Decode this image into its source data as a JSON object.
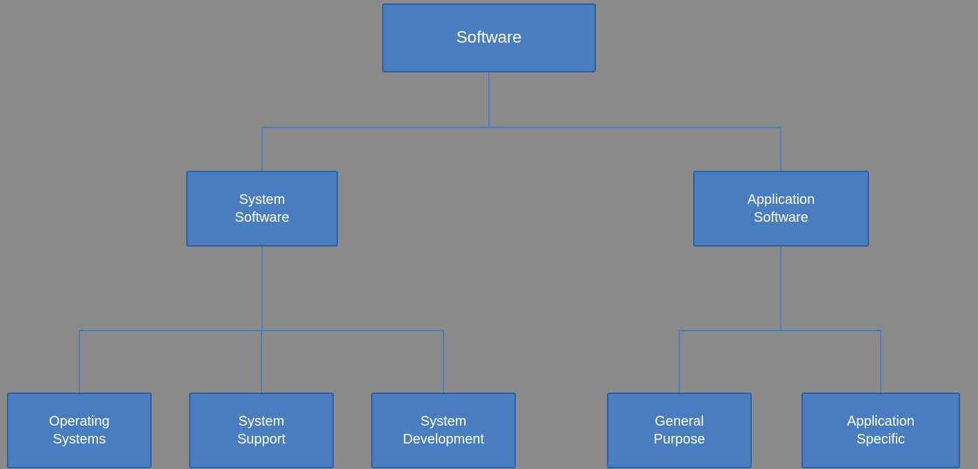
{
  "nodes": {
    "software": {
      "label": "Software"
    },
    "system_software": {
      "label": "System\nSoftware"
    },
    "application_software": {
      "label": "Application\nSoftware"
    },
    "operating_systems": {
      "label": "Operating\nSystems"
    },
    "system_support": {
      "label": "System\nSupport"
    },
    "system_development": {
      "label": "System\nDevelopment"
    },
    "general_purpose": {
      "label": "General\nPurpose"
    },
    "application_specific": {
      "label": "Application\nSpecific"
    }
  },
  "colors": {
    "node_bg": "#4a7dbf",
    "node_border": "#2d5f9e",
    "connector": "#4a7dbf",
    "background": "#8a8a8a"
  }
}
